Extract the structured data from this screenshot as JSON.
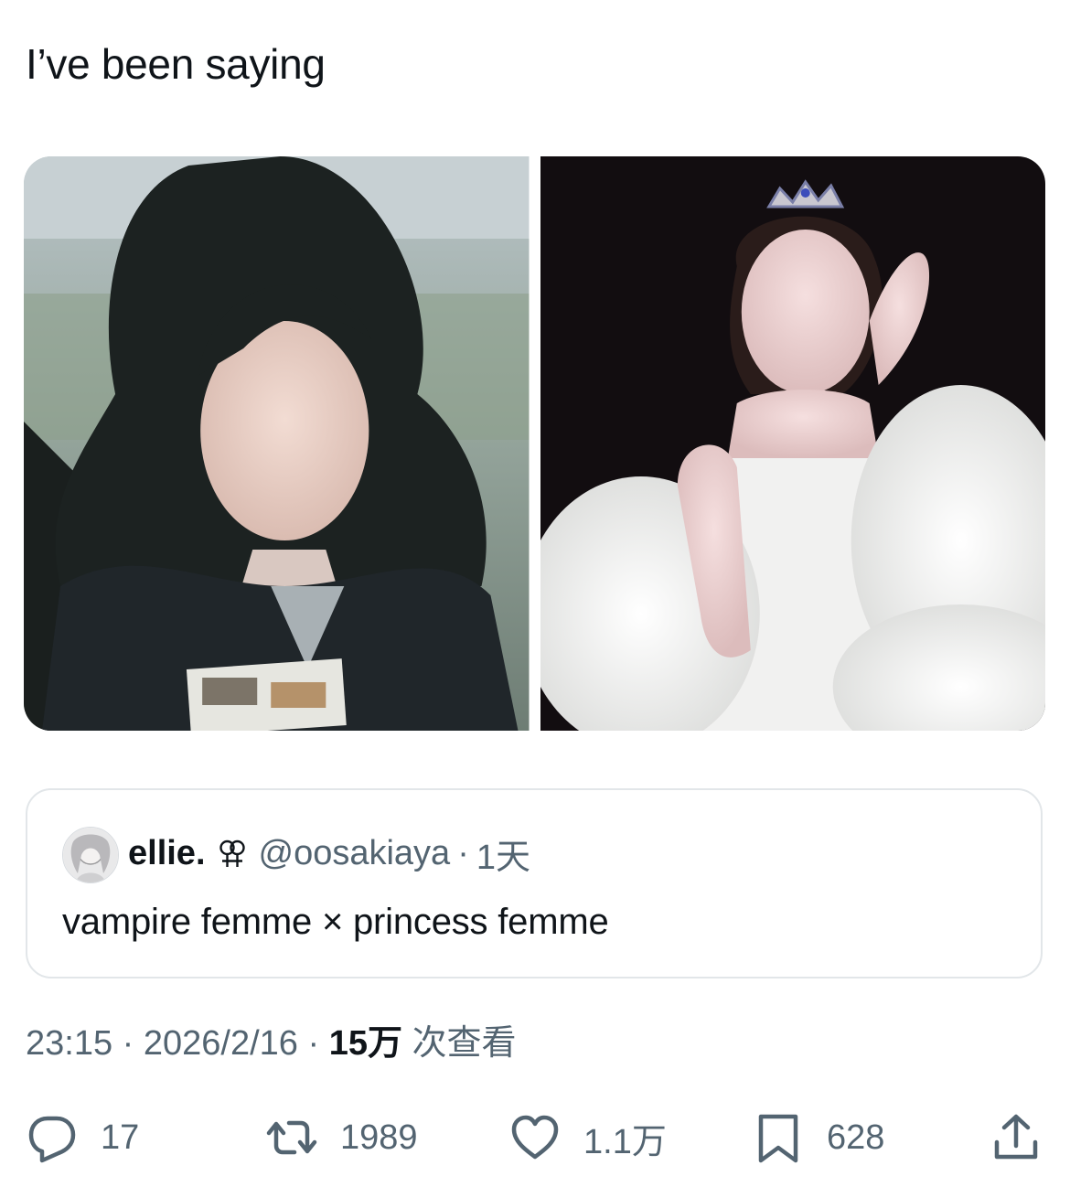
{
  "tweet": {
    "text": "I’ve been saying"
  },
  "quote": {
    "name": "ellie.",
    "handle": "@oosakiaya",
    "separator": "·",
    "time": "1天",
    "text": "vampire femme × princess femme"
  },
  "meta": {
    "time": "23:15",
    "sep1": " · ",
    "date": "2026/2/16",
    "sep2": " · ",
    "views": "15万",
    "views_suffix": " 次查看"
  },
  "actions": {
    "replies": "17",
    "retweets": "1989",
    "likes": "1.1万",
    "bookmarks": "628"
  },
  "icons": {
    "reply": "reply-icon",
    "retweet": "retweet-icon",
    "like": "heart-icon",
    "bookmark": "bookmark-icon",
    "share": "share-icon",
    "quote_symbol": "venus-double-icon"
  },
  "colors": {
    "text": "#0f1419",
    "secondary": "#536471",
    "border": "#e2e6e9"
  }
}
